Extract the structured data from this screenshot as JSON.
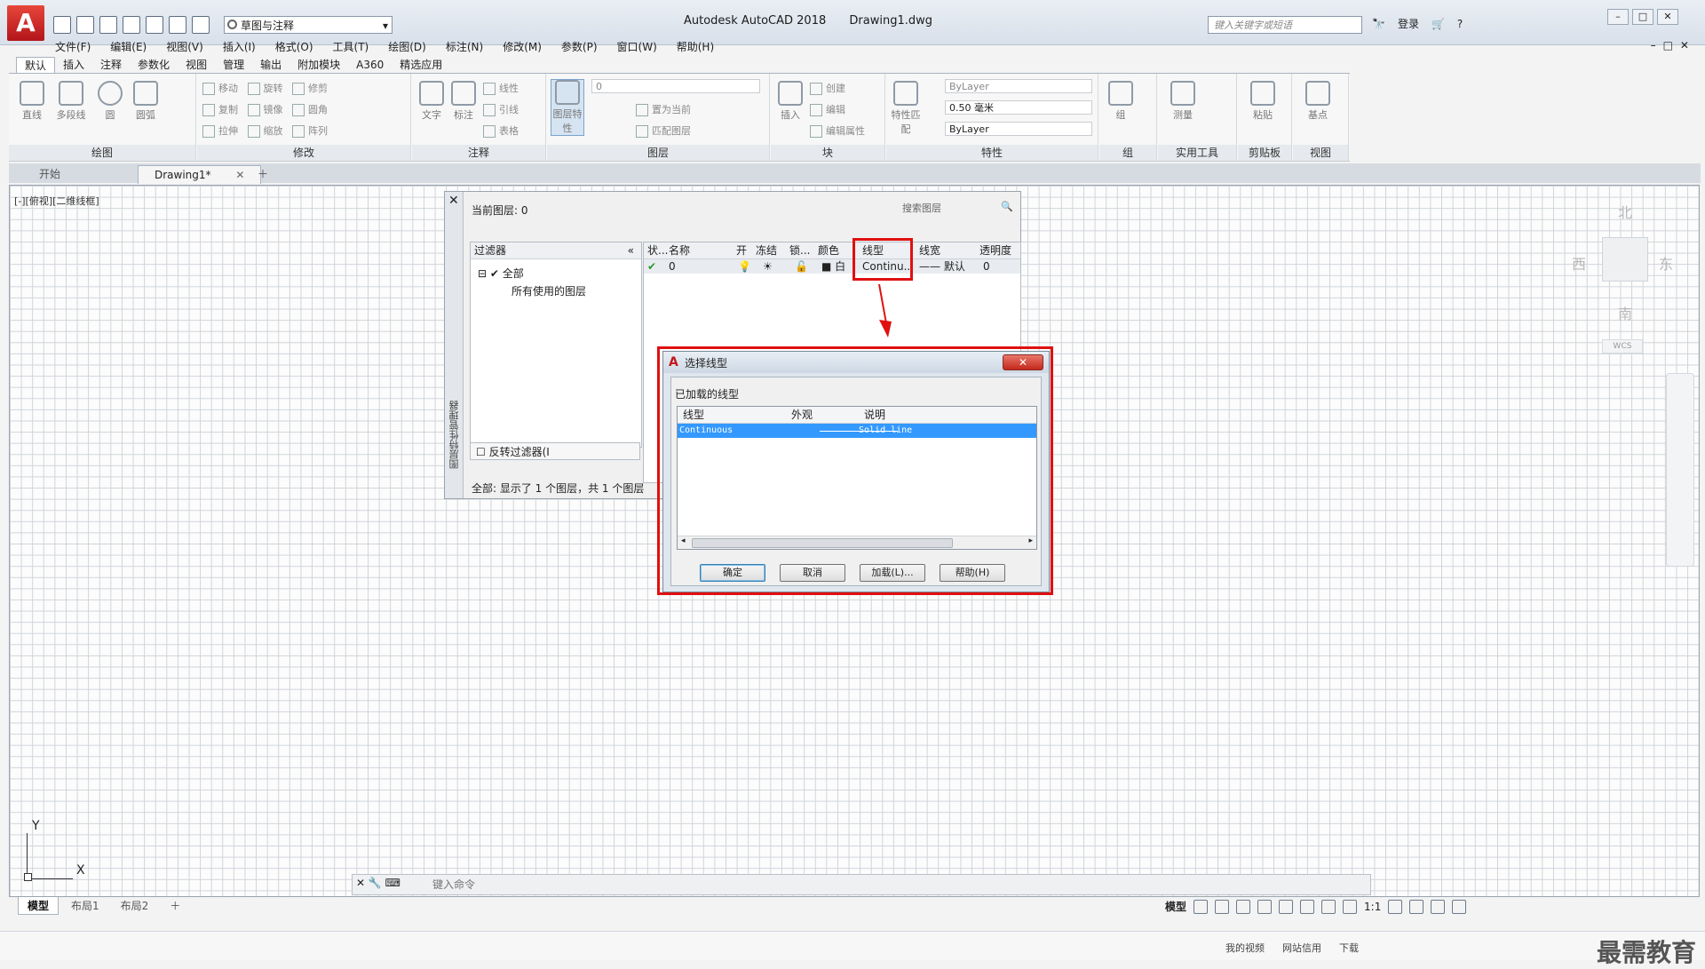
{
  "title_bar": {
    "app_name": "Autodesk AutoCAD 2018",
    "document": "Drawing1.dwg",
    "workspace": "草图与注释",
    "search_placeholder": "键入关键字或短语",
    "login": "登录"
  },
  "menu": [
    "文件(F)",
    "编辑(E)",
    "视图(V)",
    "插入(I)",
    "格式(O)",
    "工具(T)",
    "绘图(D)",
    "标注(N)",
    "修改(M)",
    "参数(P)",
    "窗口(W)",
    "帮助(H)"
  ],
  "ribbon_tabs": [
    "默认",
    "插入",
    "注释",
    "参数化",
    "视图",
    "管理",
    "输出",
    "附加模块",
    "A360",
    "精选应用"
  ],
  "ribbon": {
    "draw": {
      "title": "绘图",
      "tools": [
        "直线",
        "多段线",
        "圆",
        "圆弧"
      ]
    },
    "modify": {
      "title": "修改",
      "rows": [
        [
          "移动",
          "旋转",
          "修剪"
        ],
        [
          "复制",
          "镜像",
          "圆角"
        ],
        [
          "拉伸",
          "缩放",
          "阵列"
        ]
      ]
    },
    "annotate": {
      "title": "注释",
      "big": [
        "文字",
        "标注"
      ],
      "small": [
        "线性",
        "引线",
        "表格"
      ]
    },
    "layers": {
      "title": "图层",
      "big": "图层特性",
      "combo": "0",
      "small": [
        "置为当前",
        "匹配图层"
      ]
    },
    "block": {
      "title": "块",
      "big": "插入",
      "small": [
        "创建",
        "编辑",
        "编辑属性"
      ]
    },
    "properties": {
      "title": "特性",
      "big": "特性匹配",
      "color": "ByLayer",
      "lineweight": "0.50 毫米",
      "linetype": "ByLayer"
    },
    "group": {
      "title": "组",
      "big": "组"
    },
    "utilities": {
      "title": "实用工具",
      "big": "测量"
    },
    "clipboard": {
      "title": "剪贴板",
      "big": "粘贴"
    },
    "view": {
      "title": "视图",
      "big": "基点"
    }
  },
  "file_tabs": {
    "start": "开始",
    "drawing": "Drawing1*"
  },
  "viewport_label": "[-][俯视][二维线框]",
  "viewcube": {
    "north": "北",
    "south": "南",
    "east": "东",
    "west": "西",
    "wcs": "WCS"
  },
  "ucs": {
    "x": "X",
    "y": "Y"
  },
  "layer_manager": {
    "side_title": "图层特性管理器",
    "current_layer": "当前图层: 0",
    "search_placeholder": "搜索图层",
    "filters_header": "过滤器",
    "tree": [
      "全部",
      "所有使用的图层"
    ],
    "invert_filter": "反转过滤器(I",
    "status": "全部: 显示了 1 个图层，共 1 个图层",
    "columns": [
      "状...",
      "名称",
      "开",
      "冻结",
      "锁...",
      "颜色",
      "线型",
      "线宽",
      "透明度"
    ],
    "row": {
      "name": "0",
      "color": "白",
      "linetype": "Continu...",
      "lineweight": "默认",
      "transparency": "0"
    }
  },
  "linetype_dialog": {
    "title": "选择线型",
    "close": "✕",
    "loaded_label": "已加载的线型",
    "columns": [
      "线型",
      "外观",
      "说明"
    ],
    "rows": [
      {
        "name": "Continuous",
        "desc": "Solid line"
      }
    ],
    "buttons": {
      "ok": "确定",
      "cancel": "取消",
      "load": "加载(L)...",
      "help": "帮助(H)"
    }
  },
  "command_line": {
    "placeholder": "键入命令"
  },
  "layout_tabs": [
    "模型",
    "布局1",
    "布局2"
  ],
  "status": {
    "model": "模型",
    "scale": "1:1"
  },
  "taskbar": [
    "我的视频",
    "网站信用",
    "下载"
  ],
  "watermark": "最需教育"
}
